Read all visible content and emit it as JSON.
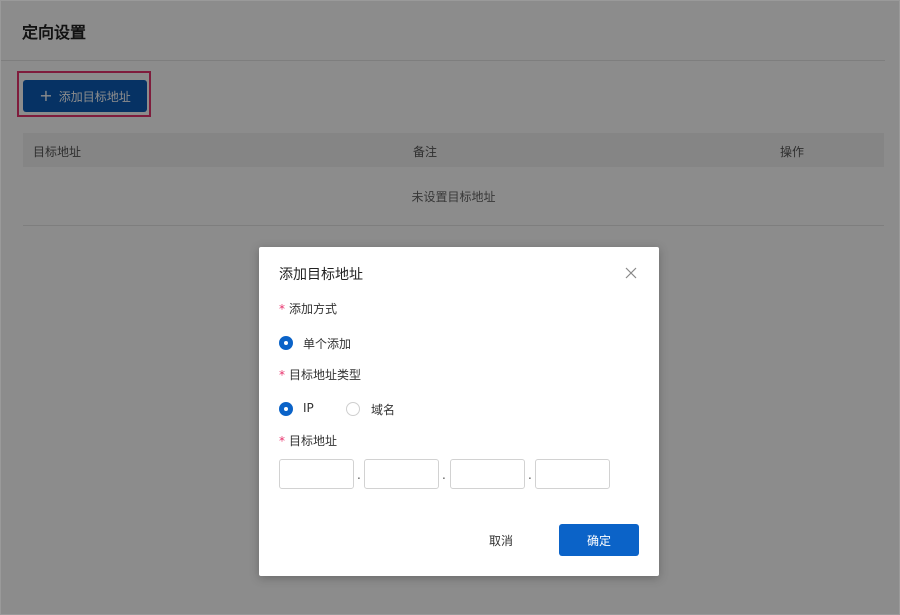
{
  "page": {
    "title": "定向设置",
    "add_button_label": "添加目标地址",
    "plus_icon": "plus-icon",
    "highlight_color": "#e8336d"
  },
  "table": {
    "columns": [
      "目标地址",
      "备注",
      "操作"
    ],
    "empty_text": "未设置目标地址"
  },
  "dialog": {
    "title": "添加目标地址",
    "close_icon": "close-icon",
    "fields": {
      "method_label": "添加方式",
      "method_option": "单个添加",
      "type_label": "目标地址类型",
      "type_options": [
        "IP",
        "域名"
      ],
      "type_selected": "IP",
      "address_label": "目标地址",
      "ip_separators": [
        ".",
        ".",
        "."
      ],
      "ip_values": [
        "",
        "",
        "",
        ""
      ]
    },
    "cancel_label": "取消",
    "confirm_label": "确定",
    "accent_color": "#0b63c8"
  }
}
